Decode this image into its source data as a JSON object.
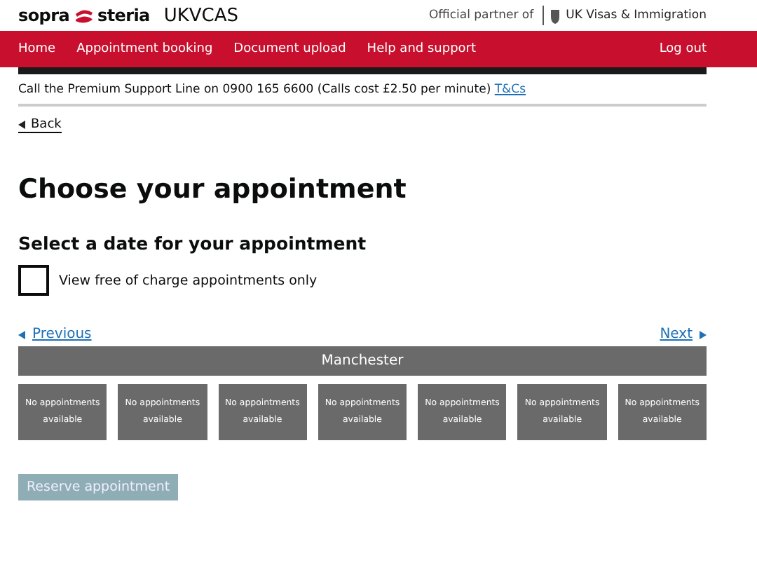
{
  "header": {
    "brand": [
      "sopra",
      "steria"
    ],
    "product": "UKVCAS",
    "partner_label": "Official partner of",
    "partner_name": "UK Visas & Immigration"
  },
  "nav": {
    "items": [
      {
        "label": "Home"
      },
      {
        "label": "Appointment booking"
      },
      {
        "label": "Document upload"
      },
      {
        "label": "Help and support"
      }
    ],
    "logout": "Log out"
  },
  "support_line": {
    "text": "Call the Premium Support Line on 0900 165 6600 (Calls cost £2.50 per minute)",
    "link": "T&Cs"
  },
  "back": "Back",
  "title": "Choose your appointment",
  "subtitle": "Select a date for your appointment",
  "free_only": {
    "label": "View free of charge appointments only",
    "checked": false
  },
  "pager": {
    "previous": "Previous",
    "next": "Next"
  },
  "location": "Manchester",
  "slots": [
    {
      "text": "No appointments available",
      "available": false
    },
    {
      "text": "No appointments available",
      "available": false
    },
    {
      "text": "No appointments available",
      "available": false
    },
    {
      "text": "No appointments available",
      "available": false
    },
    {
      "text": "No appointments available",
      "available": false
    },
    {
      "text": "No appointments available",
      "available": false
    },
    {
      "text": "No appointments available",
      "available": false
    }
  ],
  "reserve": {
    "label": "Reserve appointment",
    "disabled": true
  }
}
